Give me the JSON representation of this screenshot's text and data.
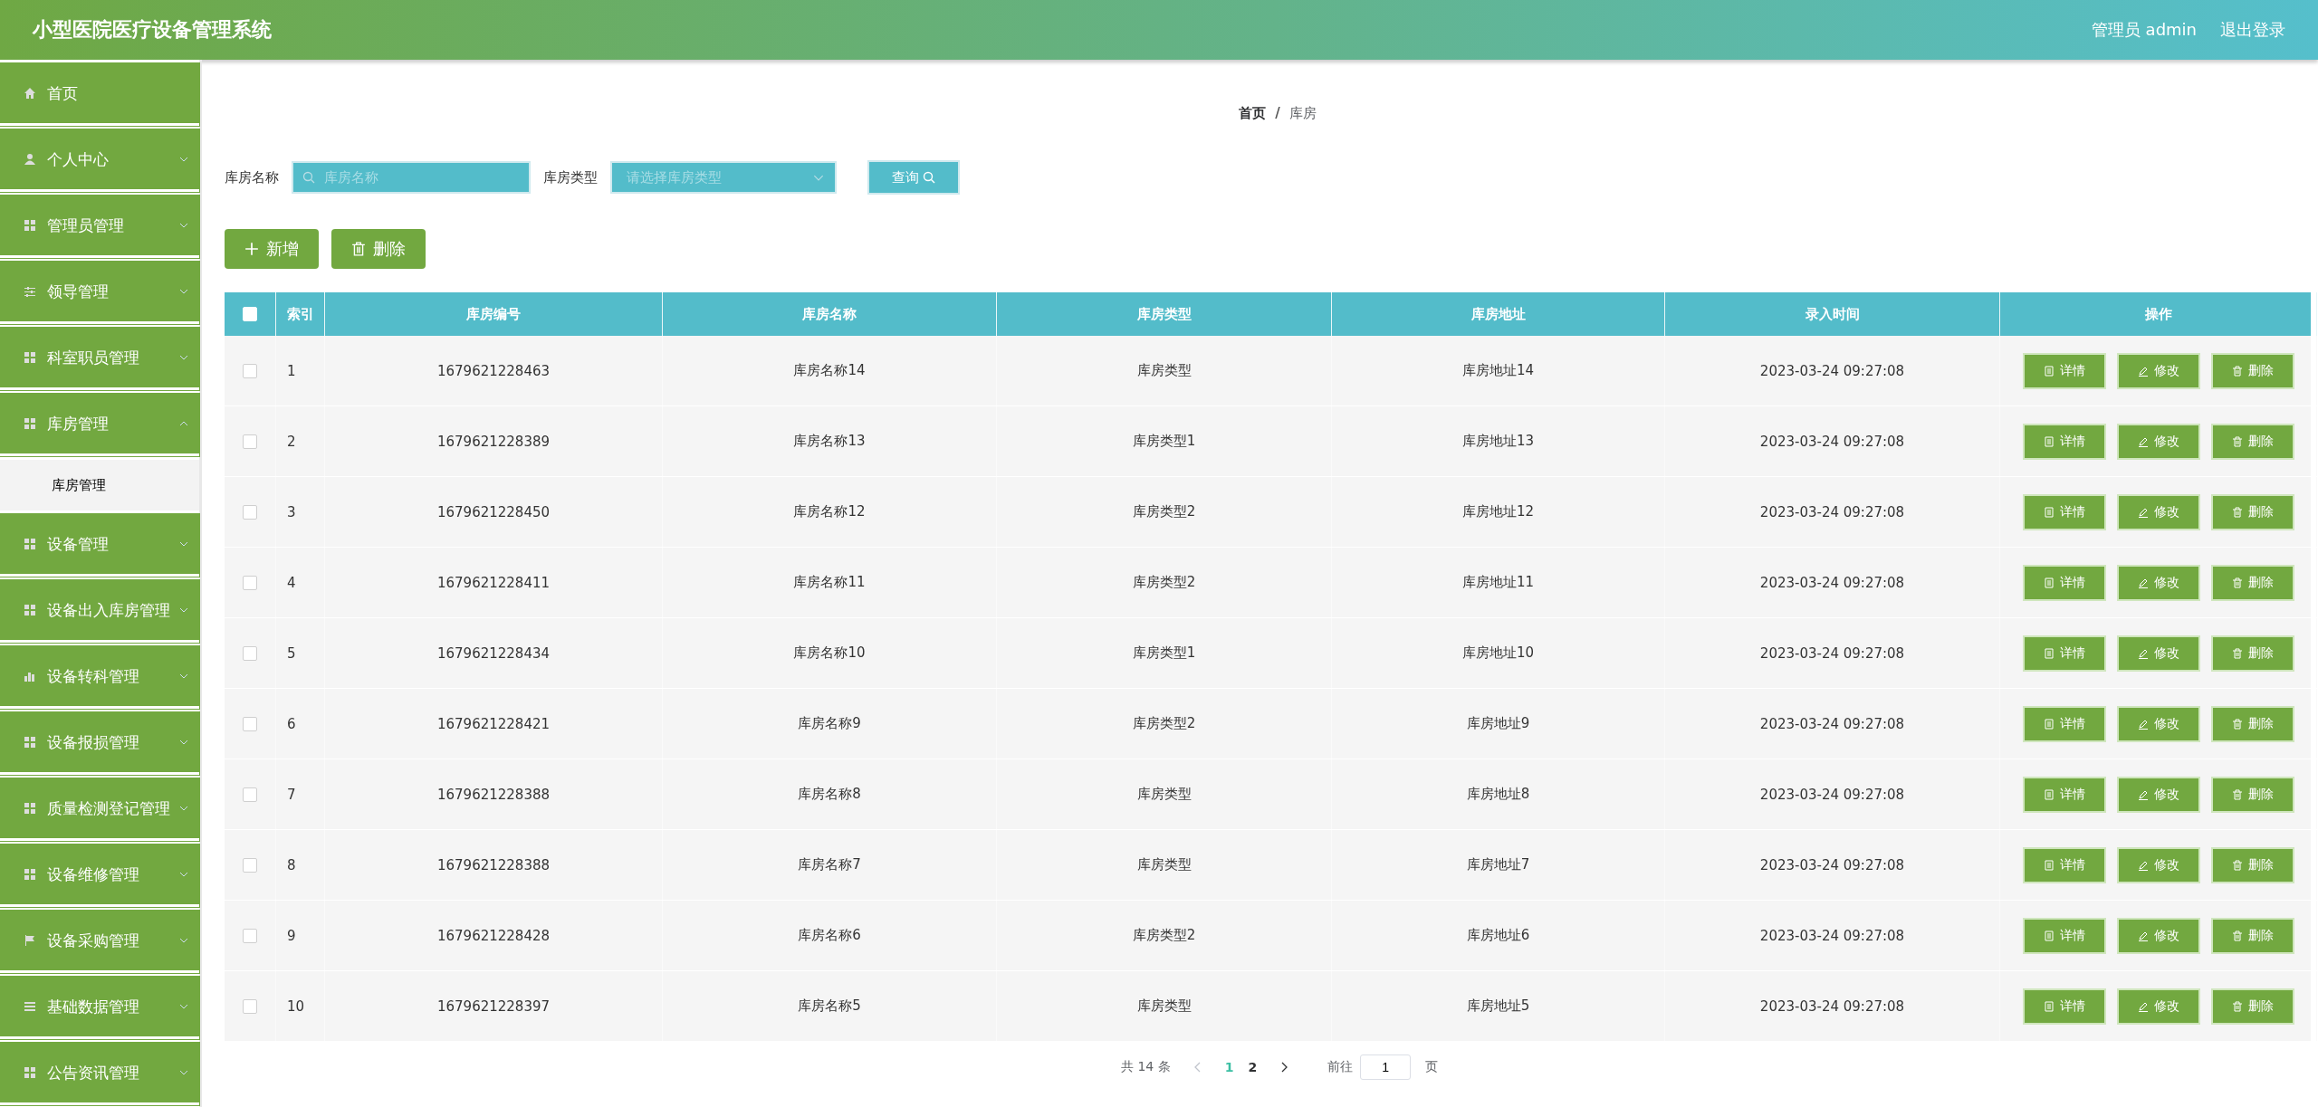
{
  "header": {
    "title": "小型医院医疗设备管理系统",
    "user": "管理员 admin",
    "logout": "退出登录"
  },
  "sidebar": {
    "items": [
      {
        "label": "首页",
        "expandable": false
      },
      {
        "label": "个人中心",
        "expandable": true,
        "expanded": false
      },
      {
        "label": "管理员管理",
        "expandable": true,
        "expanded": false
      },
      {
        "label": "领导管理",
        "expandable": true,
        "expanded": false
      },
      {
        "label": "科室职员管理",
        "expandable": true,
        "expanded": false
      },
      {
        "label": "库房管理",
        "expandable": true,
        "expanded": true,
        "children": [
          {
            "label": "库房管理",
            "selected": true
          }
        ]
      },
      {
        "label": "设备管理",
        "expandable": true,
        "expanded": false
      },
      {
        "label": "设备出入库房管理",
        "expandable": true,
        "expanded": false
      },
      {
        "label": "设备转科管理",
        "expandable": true,
        "expanded": false
      },
      {
        "label": "设备报损管理",
        "expandable": true,
        "expanded": false
      },
      {
        "label": "质量检测登记管理",
        "expandable": true,
        "expanded": false
      },
      {
        "label": "设备维修管理",
        "expandable": true,
        "expanded": false
      },
      {
        "label": "设备采购管理",
        "expandable": true,
        "expanded": false
      },
      {
        "label": "基础数据管理",
        "expandable": true,
        "expanded": false
      },
      {
        "label": "公告资讯管理",
        "expandable": true,
        "expanded": false
      }
    ]
  },
  "breadcrumb": {
    "items": [
      "首页",
      "库房"
    ],
    "separator": "/"
  },
  "search": {
    "fields": [
      {
        "label": "库房名称",
        "kind": "text",
        "placeholder": "库房名称"
      },
      {
        "label": "库房类型",
        "kind": "select",
        "placeholder": "请选择库房类型"
      }
    ],
    "button": "查询"
  },
  "actions": [
    {
      "label": "新增",
      "kind": "add"
    },
    {
      "label": "删除",
      "kind": "delete"
    }
  ],
  "table": {
    "all_checked": false,
    "columns": [
      "索引",
      "库房编号",
      "库房名称",
      "库房类型",
      "库房地址",
      "录入时间",
      "操作"
    ],
    "rows": [
      {
        "checked": false,
        "cells": [
          "1",
          "1679621228463",
          "库房名称14",
          "库房类型",
          "库房地址14",
          "2023-03-24 09:27:08"
        ],
        "actions": [
          {
            "label": "详情",
            "kind": "detail"
          },
          {
            "label": "修改",
            "kind": "edit"
          },
          {
            "label": "删除",
            "kind": "delete"
          }
        ]
      },
      {
        "checked": false,
        "cells": [
          "2",
          "1679621228389",
          "库房名称13",
          "库房类型1",
          "库房地址13",
          "2023-03-24 09:27:08"
        ],
        "actions": [
          {
            "label": "详情",
            "kind": "detail"
          },
          {
            "label": "修改",
            "kind": "edit"
          },
          {
            "label": "删除",
            "kind": "delete"
          }
        ]
      },
      {
        "checked": false,
        "cells": [
          "3",
          "1679621228450",
          "库房名称12",
          "库房类型2",
          "库房地址12",
          "2023-03-24 09:27:08"
        ],
        "actions": [
          {
            "label": "详情",
            "kind": "detail"
          },
          {
            "label": "修改",
            "kind": "edit"
          },
          {
            "label": "删除",
            "kind": "delete"
          }
        ]
      },
      {
        "checked": false,
        "cells": [
          "4",
          "1679621228411",
          "库房名称11",
          "库房类型2",
          "库房地址11",
          "2023-03-24 09:27:08"
        ],
        "actions": [
          {
            "label": "详情",
            "kind": "detail"
          },
          {
            "label": "修改",
            "kind": "edit"
          },
          {
            "label": "删除",
            "kind": "delete"
          }
        ]
      },
      {
        "checked": false,
        "cells": [
          "5",
          "1679621228434",
          "库房名称10",
          "库房类型1",
          "库房地址10",
          "2023-03-24 09:27:08"
        ],
        "actions": [
          {
            "label": "详情",
            "kind": "detail"
          },
          {
            "label": "修改",
            "kind": "edit"
          },
          {
            "label": "删除",
            "kind": "delete"
          }
        ]
      },
      {
        "checked": false,
        "cells": [
          "6",
          "1679621228421",
          "库房名称9",
          "库房类型2",
          "库房地址9",
          "2023-03-24 09:27:08"
        ],
        "actions": [
          {
            "label": "详情",
            "kind": "detail"
          },
          {
            "label": "修改",
            "kind": "edit"
          },
          {
            "label": "删除",
            "kind": "delete"
          }
        ]
      },
      {
        "checked": false,
        "cells": [
          "7",
          "1679621228388",
          "库房名称8",
          "库房类型",
          "库房地址8",
          "2023-03-24 09:27:08"
        ],
        "actions": [
          {
            "label": "详情",
            "kind": "detail"
          },
          {
            "label": "修改",
            "kind": "edit"
          },
          {
            "label": "删除",
            "kind": "delete"
          }
        ]
      },
      {
        "checked": false,
        "cells": [
          "8",
          "1679621228388",
          "库房名称7",
          "库房类型",
          "库房地址7",
          "2023-03-24 09:27:08"
        ],
        "actions": [
          {
            "label": "详情",
            "kind": "detail"
          },
          {
            "label": "修改",
            "kind": "edit"
          },
          {
            "label": "删除",
            "kind": "delete"
          }
        ]
      },
      {
        "checked": false,
        "cells": [
          "9",
          "1679621228428",
          "库房名称6",
          "库房类型2",
          "库房地址6",
          "2023-03-24 09:27:08"
        ],
        "actions": [
          {
            "label": "详情",
            "kind": "detail"
          },
          {
            "label": "修改",
            "kind": "edit"
          },
          {
            "label": "删除",
            "kind": "delete"
          }
        ]
      },
      {
        "checked": false,
        "cells": [
          "10",
          "1679621228397",
          "库房名称5",
          "库房类型",
          "库房地址5",
          "2023-03-24 09:27:08"
        ],
        "actions": [
          {
            "label": "详情",
            "kind": "detail"
          },
          {
            "label": "修改",
            "kind": "edit"
          },
          {
            "label": "删除",
            "kind": "delete"
          }
        ]
      }
    ]
  },
  "pagination": {
    "total": "共 14 条",
    "pages": [
      {
        "label": "1",
        "selected": true
      },
      {
        "label": "2",
        "selected": false
      }
    ],
    "goto": "前往",
    "page_input": "1",
    "page_unit": "页"
  }
}
